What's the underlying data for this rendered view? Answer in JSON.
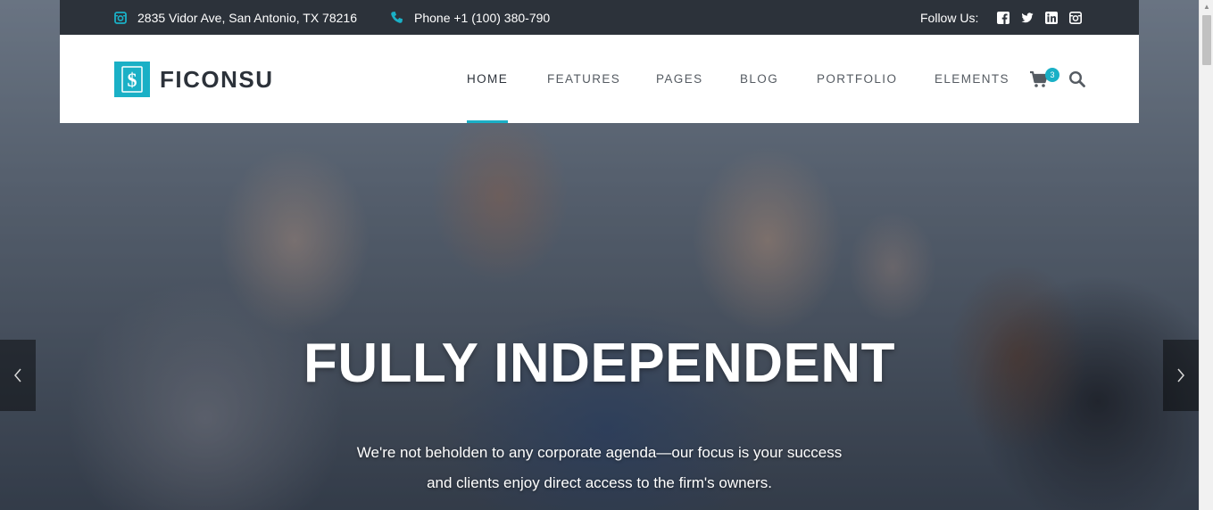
{
  "topbar": {
    "address": "2835 Vidor Ave, San Antonio, TX 78216",
    "phone": "Phone +1 (100) 380-790",
    "follow_label": "Follow Us:",
    "social_icons": [
      "facebook-icon",
      "twitter-icon",
      "linkedin-icon",
      "instagram-icon"
    ]
  },
  "header": {
    "logo_text": "FICONSU",
    "nav": [
      {
        "label": "HOME",
        "active": true
      },
      {
        "label": "FEATURES"
      },
      {
        "label": "PAGES"
      },
      {
        "label": "BLOG"
      },
      {
        "label": "PORTFOLIO"
      },
      {
        "label": "ELEMENTS"
      }
    ],
    "cart_count": "3"
  },
  "hero": {
    "title": "FULLY INDEPENDENT",
    "subtitle_line1": "We're not beholden to any corporate agenda—our focus is your success",
    "subtitle_line2": "and clients enjoy direct access to the firm's owners."
  },
  "colors": {
    "accent": "#1ab0c6",
    "topbar_bg": "#2c323a",
    "header_bg": "#ffffff",
    "nav_text": "#555b62"
  }
}
